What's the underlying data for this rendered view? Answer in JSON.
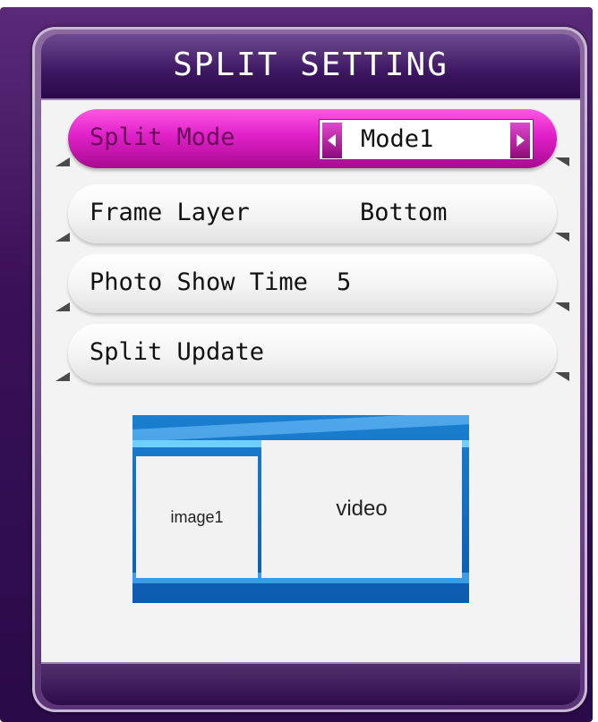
{
  "title": "SPLIT SETTING",
  "menu": {
    "split_mode": {
      "label": "Split Mode",
      "value": "Mode1"
    },
    "frame_layer": {
      "label": "Frame Layer",
      "value": "Bottom"
    },
    "photo_show_time": {
      "label": "Photo Show Time",
      "value": "5"
    },
    "split_update": {
      "label": "Split Update"
    }
  },
  "preview": {
    "image_label": "image1",
    "video_label": "video"
  },
  "colors": {
    "highlight": "#e020c8",
    "frame": "#3a1058",
    "preview_bg": "#1a7fd0"
  }
}
